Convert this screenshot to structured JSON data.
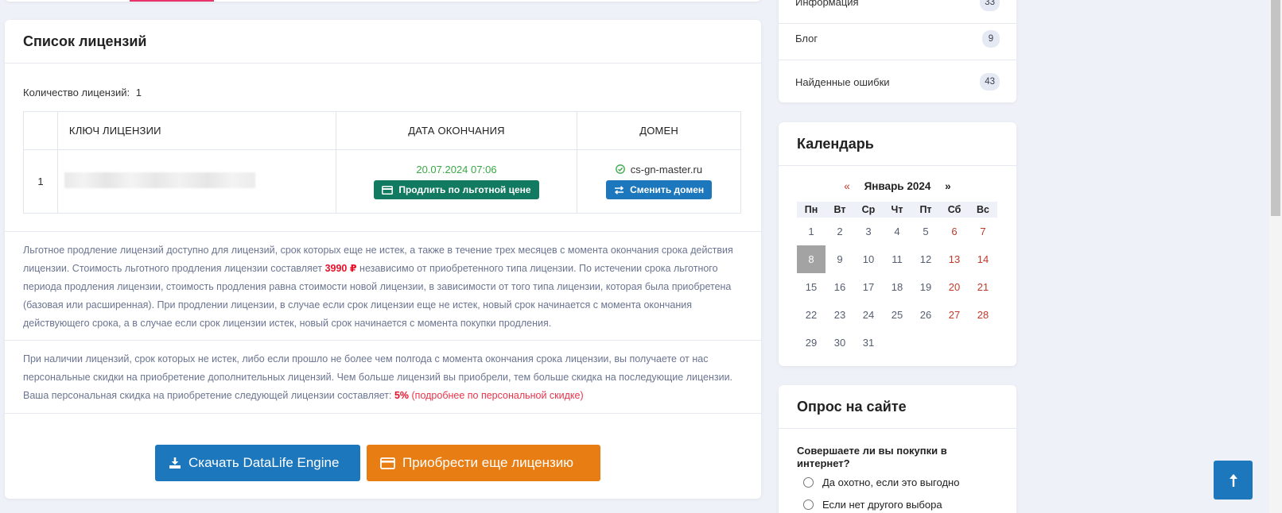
{
  "main": {
    "title": "Список лицензий",
    "license_count_label": "Количество лицензий:",
    "license_count": "1",
    "table": {
      "headers": [
        "",
        "КЛЮЧ ЛИЦЕНЗИИ",
        "ДАТА ОКОНЧАНИЯ",
        "ДОМЕН"
      ],
      "rows": [
        {
          "num": "1",
          "end_date": "20.07.2024 07:06",
          "extend_button": "Продлить по льготной цене",
          "domain": "cs-gn-master.ru",
          "change_domain_button": "Сменить домен"
        }
      ]
    },
    "note1": {
      "before_price": "Льготное продление лицензий доступно для лицензий, срок которых еще не истек, а также в течение трех месяцев с момента окончания срока действия лицензии. Стоимость льготного продления лицензии составляет",
      "price": "3990 ₽",
      "after_price": "независимо от приобретенного типа лицензии. По истечении срока льготного периода продления лицензии, стоимость продления равна стоимости новой лицензии, в зависимости от того типа лицензии, которая была приобретена (базовая или расширенная). При продлении лицензии, в случае если срок лицензии еще не истек, новый срок начинается с момента окончания действующего срока, а в случае если срок лицензии истек, новый срок начинается с момента покупки продления."
    },
    "note2": {
      "before_discount": "При наличии лицензий, срок которых не истек, либо если прошло не более чем полгода с момента окончания срока лицензии, вы получаете от нас персональные скидки на приобретение дополнительных лицензий. Чем больше лицензий вы приобрели, тем больше скидка на последующие лицензии. Ваша персональная скидка на приобретение следующей лицензии составляет:",
      "discount": "5%",
      "link": "подробнее по персональной скидке"
    },
    "download_button": "Скачать DataLife Engine",
    "buy_button": "Приобрести еще лицензию"
  },
  "categories": [
    {
      "label": "Информация",
      "count": "33"
    },
    {
      "label": "Блог",
      "count": "9"
    },
    {
      "label": "Найденные ошибки",
      "count": "43"
    }
  ],
  "calendar": {
    "title": "Календарь",
    "prev": "«",
    "month": "Январь 2024",
    "next": "»",
    "weekdays": [
      "Пн",
      "Вт",
      "Ср",
      "Чт",
      "Пт",
      "Сб",
      "Вс"
    ],
    "weeks": [
      [
        "1",
        "2",
        "3",
        "4",
        "5",
        "6",
        "7"
      ],
      [
        "8",
        "9",
        "10",
        "11",
        "12",
        "13",
        "14"
      ],
      [
        "15",
        "16",
        "17",
        "18",
        "19",
        "20",
        "21"
      ],
      [
        "22",
        "23",
        "24",
        "25",
        "26",
        "27",
        "28"
      ],
      [
        "29",
        "30",
        "31",
        "",
        "",
        "",
        ""
      ]
    ],
    "today": "8"
  },
  "poll": {
    "title": "Опрос на сайте",
    "question": "Совершаете ли вы покупки в интернет?",
    "options": [
      "Да охотно, если это выгодно",
      "Если нет другого выбора"
    ]
  },
  "colors": {
    "accent_pink": "#e8346a",
    "blue": "#1c77bd",
    "green": "#127a60",
    "orange": "#e87d13",
    "price_red": "#e8102a"
  },
  "icons": {
    "extend": "credit-card-icon",
    "change_domain": "swap-arrows-icon",
    "domain_ok": "check-circle-icon",
    "download": "download-icon",
    "buy": "credit-card-icon",
    "scroll_top": "arrow-up-icon"
  }
}
